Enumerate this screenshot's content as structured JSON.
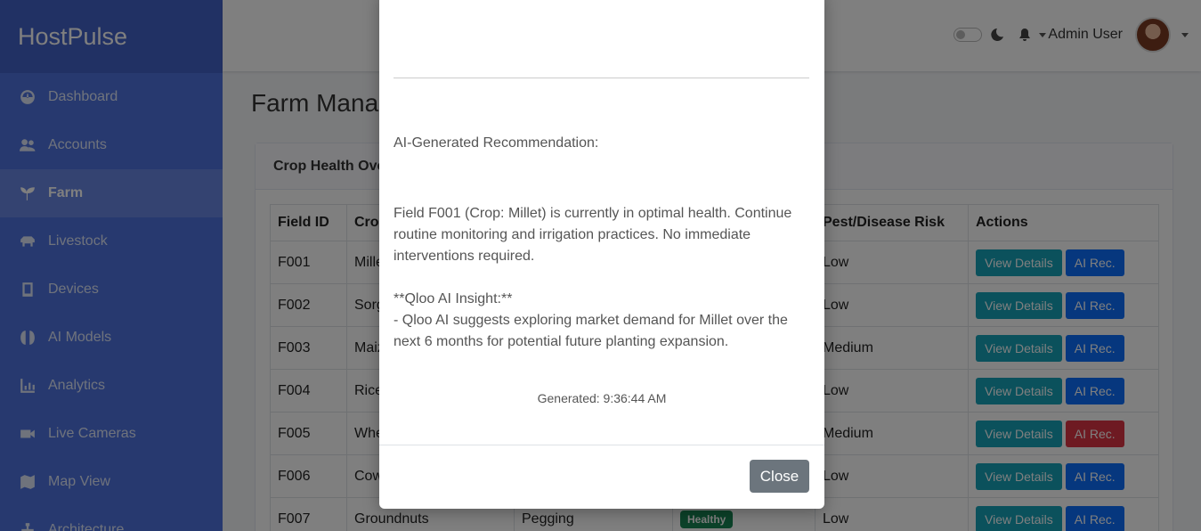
{
  "app": {
    "brand": "HostPulse"
  },
  "sidebar": {
    "items": [
      {
        "label": "Dashboard",
        "icon": "gauge-icon"
      },
      {
        "label": "Accounts",
        "icon": "users-icon"
      },
      {
        "label": "Farm",
        "icon": "seedling-icon",
        "active": true
      },
      {
        "label": "Livestock",
        "icon": "livestock-icon"
      },
      {
        "label": "Devices",
        "icon": "tablet-icon"
      },
      {
        "label": "AI Models",
        "icon": "brain-icon"
      },
      {
        "label": "Analytics",
        "icon": "chart-icon"
      },
      {
        "label": "Live Cameras",
        "icon": "video-icon"
      },
      {
        "label": "Map View",
        "icon": "map-icon"
      },
      {
        "label": "Architecture",
        "icon": "sitemap-icon"
      }
    ]
  },
  "topbar": {
    "user_name": "Admin User"
  },
  "page": {
    "title": "Farm Mana"
  },
  "card": {
    "header": "Crop Health Ove",
    "columns": [
      "Field ID",
      "Cro",
      "",
      "",
      "Pest/Disease Risk",
      "Actions"
    ],
    "rows": [
      {
        "id": "F001",
        "crop": "Mille",
        "stage": "",
        "status": "",
        "risk": "Low",
        "view": "View Details",
        "ai": "AI Rec.",
        "ai_style": "primary"
      },
      {
        "id": "F002",
        "crop": "Sorg",
        "stage": "",
        "status": "",
        "risk": "Low",
        "view": "View Details",
        "ai": "AI Rec.",
        "ai_style": "primary"
      },
      {
        "id": "F003",
        "crop": "Maiz",
        "stage": "",
        "status": "",
        "risk": "Medium",
        "view": "View Details",
        "ai": "AI Rec.",
        "ai_style": "primary"
      },
      {
        "id": "F004",
        "crop": "Rice",
        "stage": "",
        "status": "",
        "risk": "Low",
        "view": "View Details",
        "ai": "AI Rec.",
        "ai_style": "primary"
      },
      {
        "id": "F005",
        "crop": "Whe",
        "stage": "",
        "status": "",
        "risk": "Medium",
        "view": "View Details",
        "ai": "AI Rec.",
        "ai_style": "danger"
      },
      {
        "id": "F006",
        "crop": "Cow",
        "stage": "",
        "status": "",
        "risk": "Low",
        "view": "View Details",
        "ai": "AI Rec.",
        "ai_style": "primary"
      },
      {
        "id": "F007",
        "crop": "Groundnuts",
        "stage": "Pegging",
        "status": "Healthy",
        "risk": "Low",
        "view": "View Details",
        "ai": "AI Rec.",
        "ai_style": "primary"
      }
    ]
  },
  "modal": {
    "heading": "AI-Generated Recommendation:",
    "paragraph1": "Field F001 (Crop: Millet) is currently in optimal health. Continue routine monitoring and irrigation practices. No immediate interventions required.",
    "insight_title": "**Qloo AI Insight:**",
    "insight_body": "- Qloo AI suggests exploring market demand for Millet over the next 6 months for potential future planting expansion.",
    "generated": "Generated: 9:36:44 AM",
    "close_label": "Close"
  },
  "colors": {
    "sidebar": "#4e73df",
    "info": "#17a2b8",
    "primary": "#0d6efd",
    "danger": "#dc3545",
    "success": "#198754"
  }
}
